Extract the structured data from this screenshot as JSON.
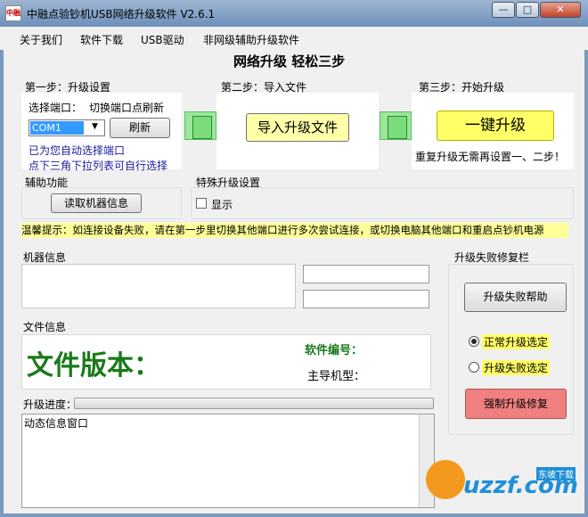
{
  "window": {
    "title": "中融点验钞机USB网络升级软件 V2.6.1",
    "icon_text": "中融",
    "min_glyph": "—",
    "max_glyph": "□",
    "close_glyph": "✕"
  },
  "menu": {
    "items": [
      "关于我们",
      "软件下载",
      "USB驱动",
      "非网级辅助升级软件"
    ]
  },
  "main": {
    "heading": "网络升级  轻松三步",
    "step1": {
      "title": "第一步：升级设置",
      "port_label": "选择端口：",
      "switch_hint": "切换端口点刷新",
      "port_value": "COM1",
      "refresh_label": "刷新",
      "auto_hint": "已为您自动选择端口",
      "dropdown_hint": "点下三角下拉列表可自行选择"
    },
    "step2": {
      "title": "第二步：导入文件",
      "import_label": "导入升级文件"
    },
    "step3": {
      "title": "第三步：开始升级",
      "upgrade_label": "一键升级",
      "note": "重复升级无需再设置一、二步！"
    },
    "aux": {
      "title": "辅助功能",
      "read_info_label": "读取机器信息"
    },
    "special": {
      "title": "特殊升级设置",
      "show_label": "显示",
      "show_checked": false
    },
    "tip": "温馨提示：如连接设备失败，请在第一步里切换其他端口进行多次尝试连接，或切换电脑其他端口和重启点钞机电源",
    "machine_info": {
      "title": "机器信息"
    },
    "file_info": {
      "title": "文件信息",
      "version_label": "文件版本：",
      "software_no_label": "软件编号：",
      "model_label": "主导机型："
    },
    "progress": {
      "label": "升级进度：",
      "value": 0
    },
    "log": {
      "text": "动态信息窗口"
    },
    "repair": {
      "title": "升级失败修复栏",
      "help_label": "升级失败帮助",
      "normal_label": "正常升级选定",
      "fail_label": "升级失败选定",
      "normal_selected": true,
      "force_repair_label": "强制升级修复"
    }
  },
  "watermark": {
    "text": "uzzf.com",
    "sub": "东坡下载"
  },
  "colors": {
    "accent_yellow": "#ffff99",
    "highlight_yellow": "#ffff66",
    "green_text": "#1a7a1a",
    "repair_red": "#f08080",
    "link_blue": "#1a1aa0"
  }
}
